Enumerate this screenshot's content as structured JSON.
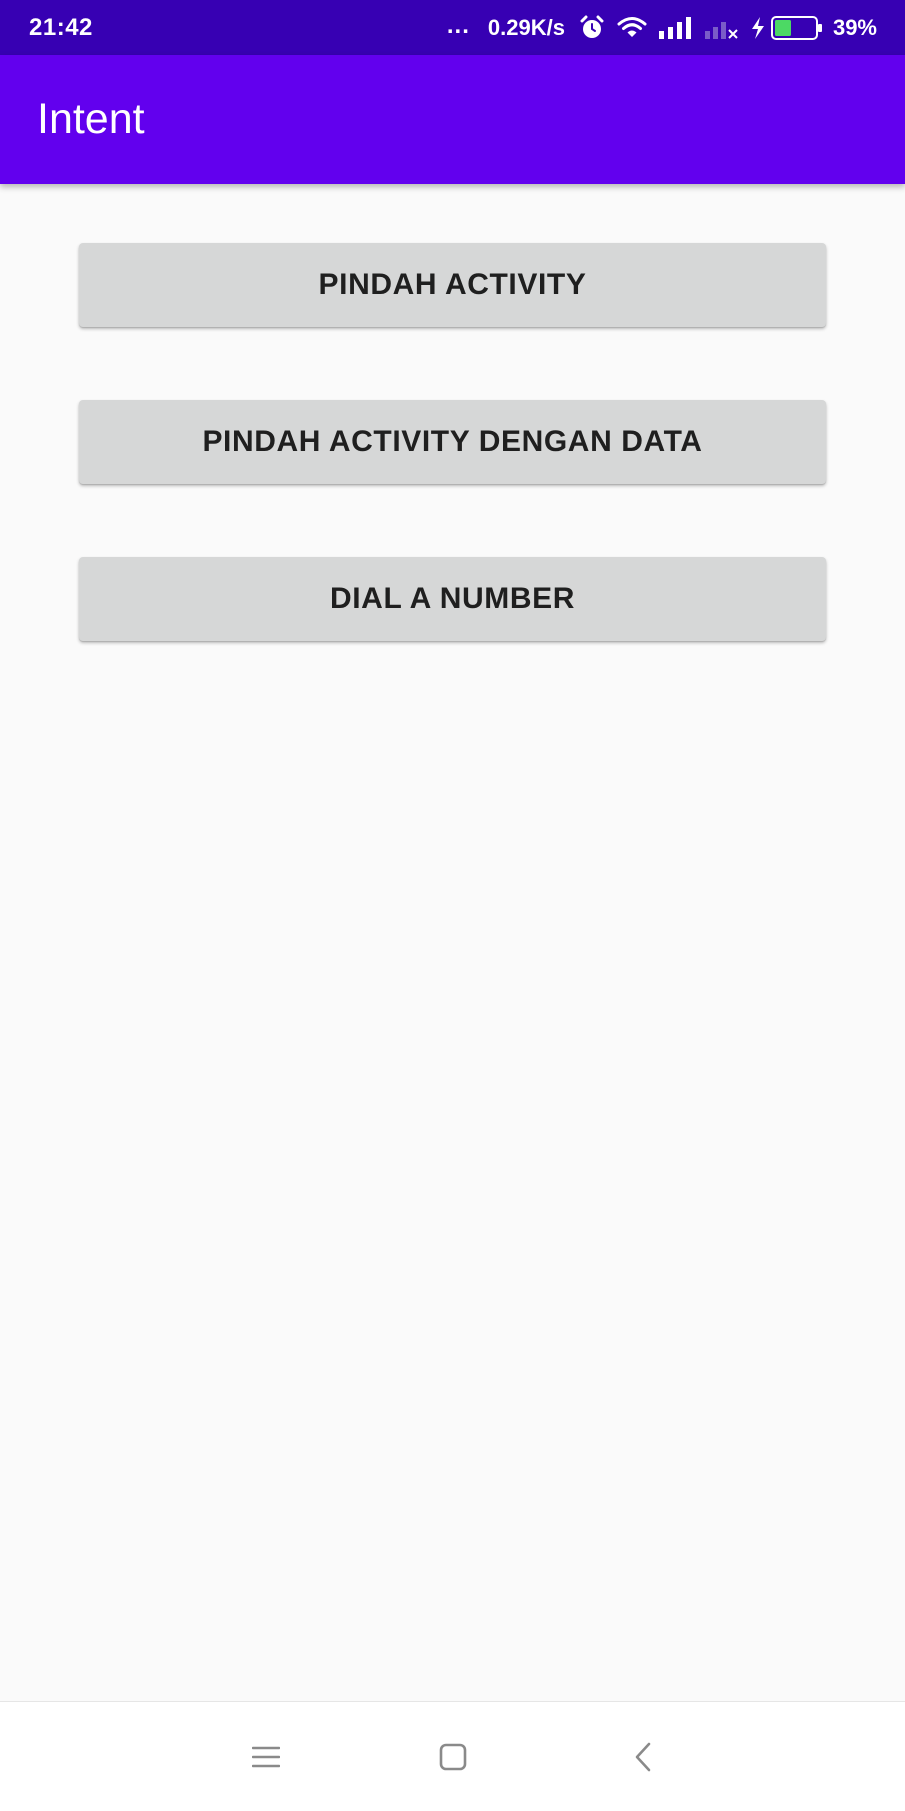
{
  "status_bar": {
    "time": "21:42",
    "dots": "...",
    "net_speed": "0.29K/s",
    "battery_pct": "39%",
    "icons": [
      "alarm-icon",
      "wifi-icon",
      "signal-icon",
      "signal-no-service-icon",
      "charging-icon",
      "battery-icon"
    ]
  },
  "app_bar": {
    "title": "Intent"
  },
  "buttons": {
    "move_activity": "PINDAH ACTIVITY",
    "move_activity_with_data": "PINDAH ACTIVITY DENGAN DATA",
    "dial_number": "DIAL A NUMBER"
  },
  "nav_bar": {
    "icons": [
      "menu-icon",
      "home-icon",
      "back-icon"
    ]
  },
  "colors": {
    "status_bar": "#3700b3",
    "app_bar": "#6200ee",
    "button_bg": "#d6d7d7",
    "background": "#fafafa",
    "battery_fill": "#4cd964"
  }
}
